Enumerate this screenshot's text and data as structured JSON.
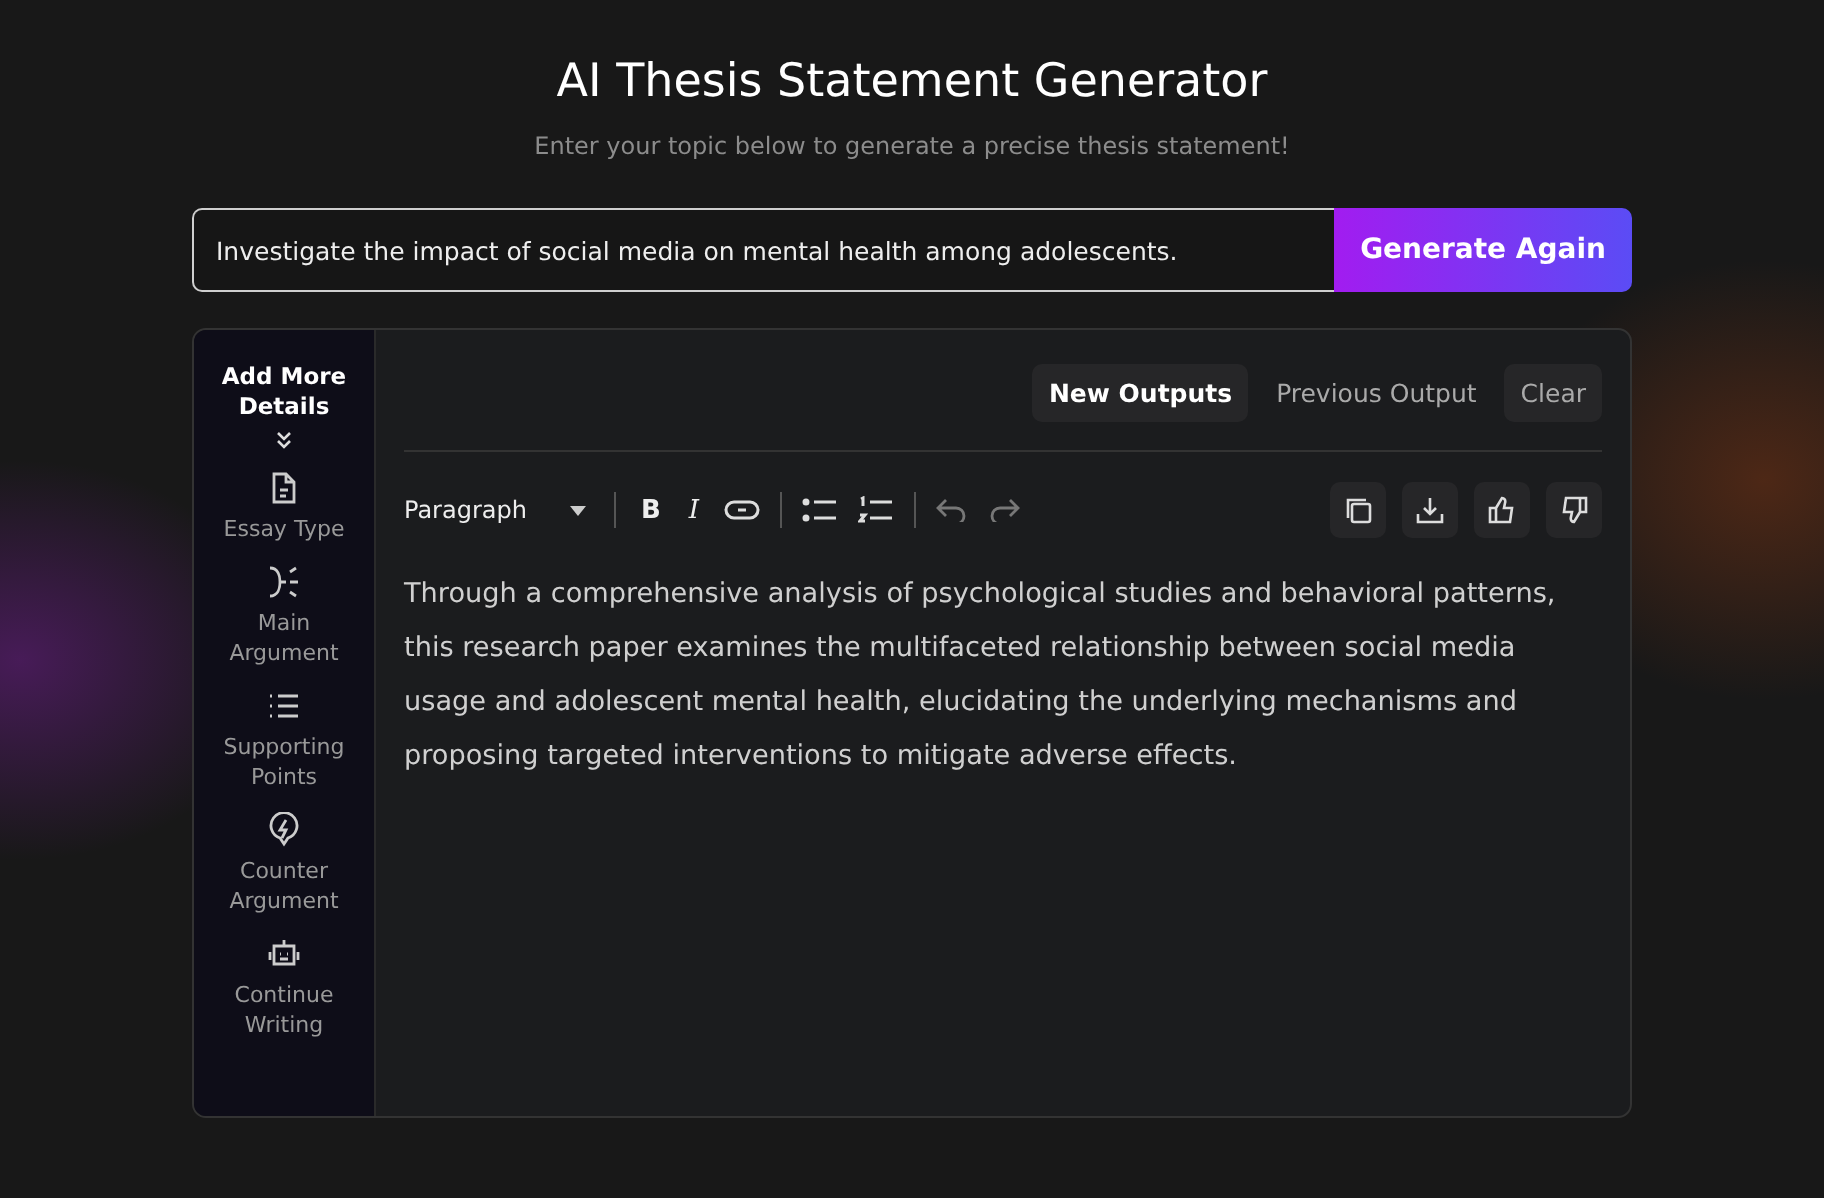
{
  "header": {
    "title": "AI Thesis Statement Generator",
    "subtitle": "Enter your topic below to generate a precise thesis statement!"
  },
  "topic": {
    "value": "Investigate the impact of social media on mental health among adolescents."
  },
  "generate_button": "Generate Again",
  "sidebar": {
    "heading": "Add More Details",
    "items": [
      {
        "label": "Essay Type",
        "kind": "document"
      },
      {
        "label": "Main Argument",
        "kind": "split"
      },
      {
        "label": "Supporting Points",
        "kind": "list"
      },
      {
        "label": "Counter Argument",
        "kind": "bolt"
      },
      {
        "label": "Continue Writing",
        "kind": "robot"
      }
    ]
  },
  "output_tabs": [
    {
      "label": "New Outputs",
      "selected": true
    },
    {
      "label": "Previous Output",
      "selected": false
    }
  ],
  "clear_button": "Clear",
  "toolbar": {
    "block_format": "Paragraph",
    "bold": "B",
    "italic": "I"
  },
  "output_text": "Through a comprehensive analysis of psychological studies and behavioral patterns, this research paper examines the multifaceted relationship between social media usage and adolescent mental health, elucidating the underlying mechanisms and proposing targeted interventions to mitigate adverse effects."
}
